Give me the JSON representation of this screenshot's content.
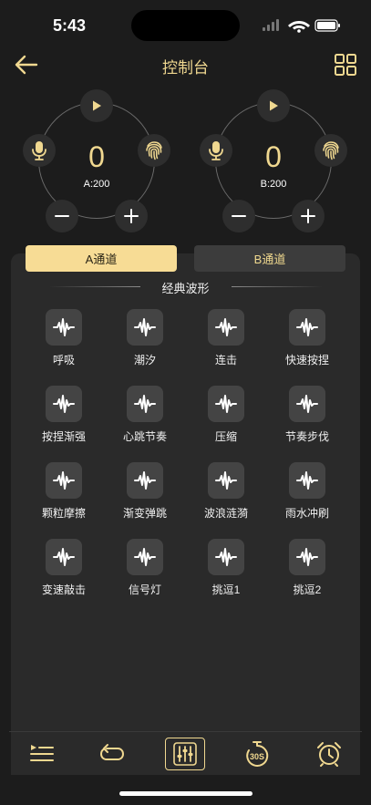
{
  "status_bar": {
    "time": "5:43"
  },
  "nav": {
    "title": "控制台",
    "back_icon": "arrow-left-icon",
    "menu_icon": "grid-icon"
  },
  "channels": [
    {
      "value": "0",
      "caption": "A:200"
    },
    {
      "value": "0",
      "caption": "B:200"
    }
  ],
  "tabs": [
    {
      "label": "A通道",
      "selected": true
    },
    {
      "label": "B通道",
      "selected": false
    }
  ],
  "section": {
    "title": "经典波形"
  },
  "waveforms": [
    {
      "label": "呼吸"
    },
    {
      "label": "潮汐"
    },
    {
      "label": "连击"
    },
    {
      "label": "快速按捏"
    },
    {
      "label": "按捏渐强"
    },
    {
      "label": "心跳节奏"
    },
    {
      "label": "压缩"
    },
    {
      "label": "节奏步伐"
    },
    {
      "label": "颗粒摩擦"
    },
    {
      "label": "渐变弹跳"
    },
    {
      "label": "波浪涟漪"
    },
    {
      "label": "雨水冲刷"
    },
    {
      "label": "变速敲击"
    },
    {
      "label": "信号灯"
    },
    {
      "label": "挑逗1"
    },
    {
      "label": "挑逗2"
    }
  ],
  "bottom_bar": {
    "items": [
      "playlist-icon",
      "loop-icon",
      "sliders-icon",
      "timer-30s-icon",
      "alarm-clock-icon"
    ],
    "active_index": 2,
    "timer_label": "30S"
  },
  "colors": {
    "accent": "#f0d890",
    "background": "#1c1c1c",
    "panel": "#2a2a2a",
    "tile": "#444444"
  }
}
